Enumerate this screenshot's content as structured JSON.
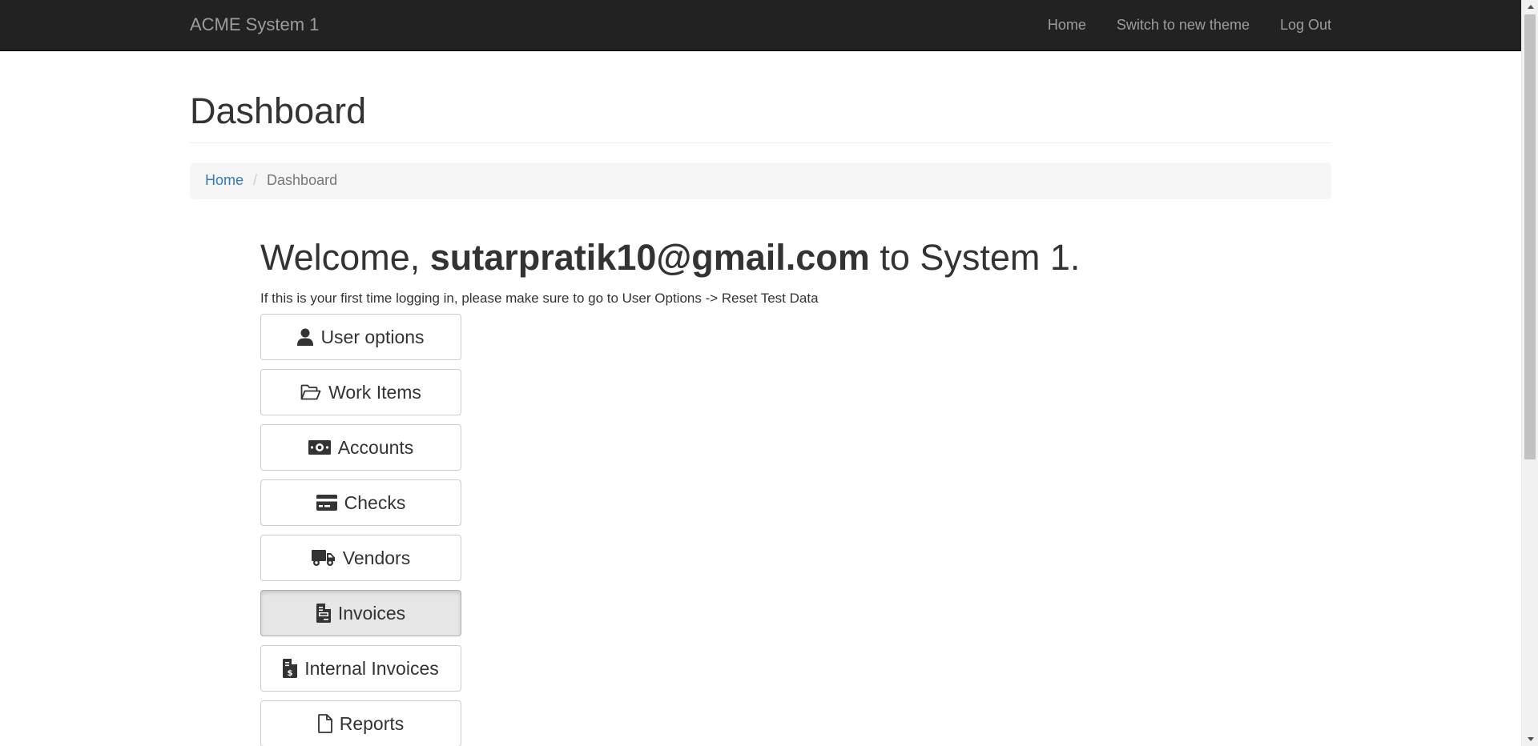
{
  "navbar": {
    "brand": "ACME System 1",
    "links": [
      "Home",
      "Switch to new theme",
      "Log Out"
    ]
  },
  "page": {
    "title": "Dashboard"
  },
  "breadcrumb": {
    "home": "Home",
    "separator": "/",
    "current": "Dashboard"
  },
  "welcome": {
    "prefix": "Welcome, ",
    "user": "sutarpratik10@gmail.com",
    "suffix": " to System 1.",
    "notice": "If this is your first time logging in, please make sure to go to User Options -> Reset Test Data"
  },
  "menu": {
    "items": [
      {
        "label": "User options",
        "icon": "user-icon"
      },
      {
        "label": "Work Items",
        "icon": "folder-open-icon"
      },
      {
        "label": "Accounts",
        "icon": "money-bill-icon"
      },
      {
        "label": "Checks",
        "icon": "credit-card-icon"
      },
      {
        "label": "Vendors",
        "icon": "truck-icon"
      },
      {
        "label": "Invoices",
        "icon": "file-invoice-icon",
        "active": true
      },
      {
        "label": "Internal Invoices",
        "icon": "file-invoice-dollar-icon"
      },
      {
        "label": "Reports",
        "icon": "file-icon"
      }
    ]
  },
  "colors": {
    "navbar_bg": "#222222",
    "navbar_text": "#9d9d9d",
    "link": "#337ab7",
    "active_button_bg": "#e6e6e6"
  }
}
